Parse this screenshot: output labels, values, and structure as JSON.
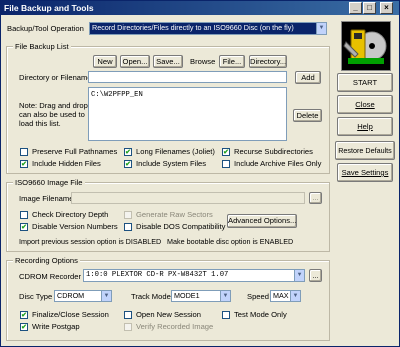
{
  "window": {
    "title": "File Backup and Tools",
    "controls": {
      "minimize": "_",
      "maximize": "□",
      "close": "×"
    }
  },
  "operation": {
    "label": "Backup/Tool Operation",
    "value": "Record Directories/Files directly to an ISO9660 Disc (on the fly)"
  },
  "file_backup_list": {
    "legend": "File Backup List",
    "new_label": "New",
    "open_label": "Open...",
    "save_label": "Save...",
    "browse_label": "Browse",
    "file_label": "File...",
    "directory_label": "Directory...",
    "dir_filename_label": "Directory or Filename",
    "dir_filename_value": "",
    "add_label": "Add",
    "note": "Note: Drag and drop can also be used to load this list.",
    "list_items": [
      "C:\\W2PFPP_EN"
    ],
    "delete_label": "Delete",
    "checkboxes": [
      {
        "label": "Preserve Full Pathnames",
        "checked": false
      },
      {
        "label": "Long Filenames (Joliet)",
        "checked": true
      },
      {
        "label": "Recurse Subdirectories",
        "checked": true
      },
      {
        "label": "Include Hidden Files",
        "checked": true
      },
      {
        "label": "Include System Files",
        "checked": true
      },
      {
        "label": "Include Archive Files Only",
        "checked": false
      }
    ]
  },
  "iso_image": {
    "legend": "ISO9660 Image File",
    "filename_label": "Image Filename",
    "filename_value": "",
    "browse_label": "...",
    "checkboxes": [
      {
        "label": "Check Directory Depth",
        "checked": false,
        "disabled": false
      },
      {
        "label": "Generate Raw Sectors",
        "checked": false,
        "disabled": true
      },
      {
        "label": "Disable Version Numbers",
        "checked": true,
        "disabled": false
      },
      {
        "label": "Disable DOS Compatibility",
        "checked": false,
        "disabled": false
      }
    ],
    "advanced_label": "Advanced Options...",
    "import_status": "Import previous session option is DISABLED",
    "bootable_status": "Make bootable disc option is ENABLED"
  },
  "recording": {
    "legend": "Recording Options",
    "recorder_label": "CDROM Recorder",
    "recorder_value": "1:0:0 PLEXTOR  CD-R   PX-W8432T 1.07",
    "recorder_btn": "...",
    "disc_type_label": "Disc Type",
    "disc_type_value": "CDROM",
    "track_mode_label": "Track Mode",
    "track_mode_value": "MODE1",
    "speed_label": "Speed",
    "speed_value": "MAX",
    "checkboxes": [
      {
        "label": "Finalize/Close Session",
        "checked": true,
        "disabled": false
      },
      {
        "label": "Open New Session",
        "checked": false,
        "disabled": false
      },
      {
        "label": "Test Mode Only",
        "checked": false,
        "disabled": false
      },
      {
        "label": "Write Postgap",
        "checked": true,
        "disabled": false
      },
      {
        "label": "Verify Recorded Image",
        "checked": false,
        "disabled": true
      }
    ]
  },
  "side_buttons": {
    "start": "START",
    "close": "Close",
    "help": "Help",
    "restore": "Restore Defaults",
    "save": "Save Settings"
  },
  "icons": {
    "logo": "cd-tools-icon",
    "check": "✔"
  }
}
